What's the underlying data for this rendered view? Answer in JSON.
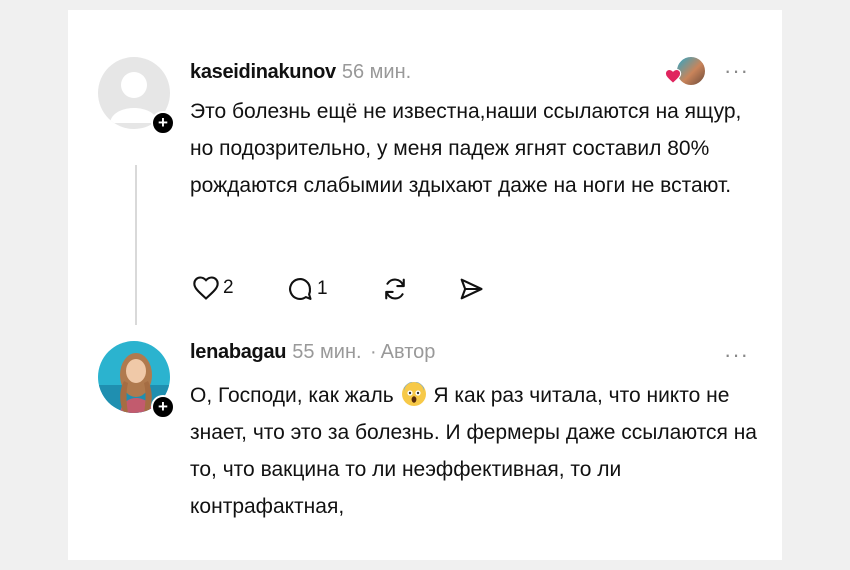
{
  "comments": [
    {
      "username": "kaseidinakunov",
      "time": "56 мин.",
      "text": "Это болезнь ещё не известна,наши ссылаются на ящур, но подозрительно, у меня падеж ягнят составил 80% рождаются слабымии здыхают даже на ноги не встают.",
      "likes": "2",
      "replies": "1",
      "more": "···",
      "liked_by_author": true
    },
    {
      "username": "lenabagau",
      "time": "55 мин.",
      "separator": "·",
      "role": "Автор",
      "text_before_emoji": "О, Господи, как жаль",
      "emoji": "scream-emoji",
      "text_after_emoji": "Я как раз читала, что никто не знает, что это за болезнь. И фермеры даже ссылаются на то, что вакцина то ли неэффективная, то ли контрафактная,",
      "more": "···"
    }
  ],
  "icons": {
    "like": "heart-icon",
    "reply": "comment-icon",
    "repost": "repost-icon",
    "share": "send-icon",
    "follow": "plus-icon"
  },
  "colors": {
    "heart_accent": "#e0245e",
    "meta_gray": "#999999"
  }
}
